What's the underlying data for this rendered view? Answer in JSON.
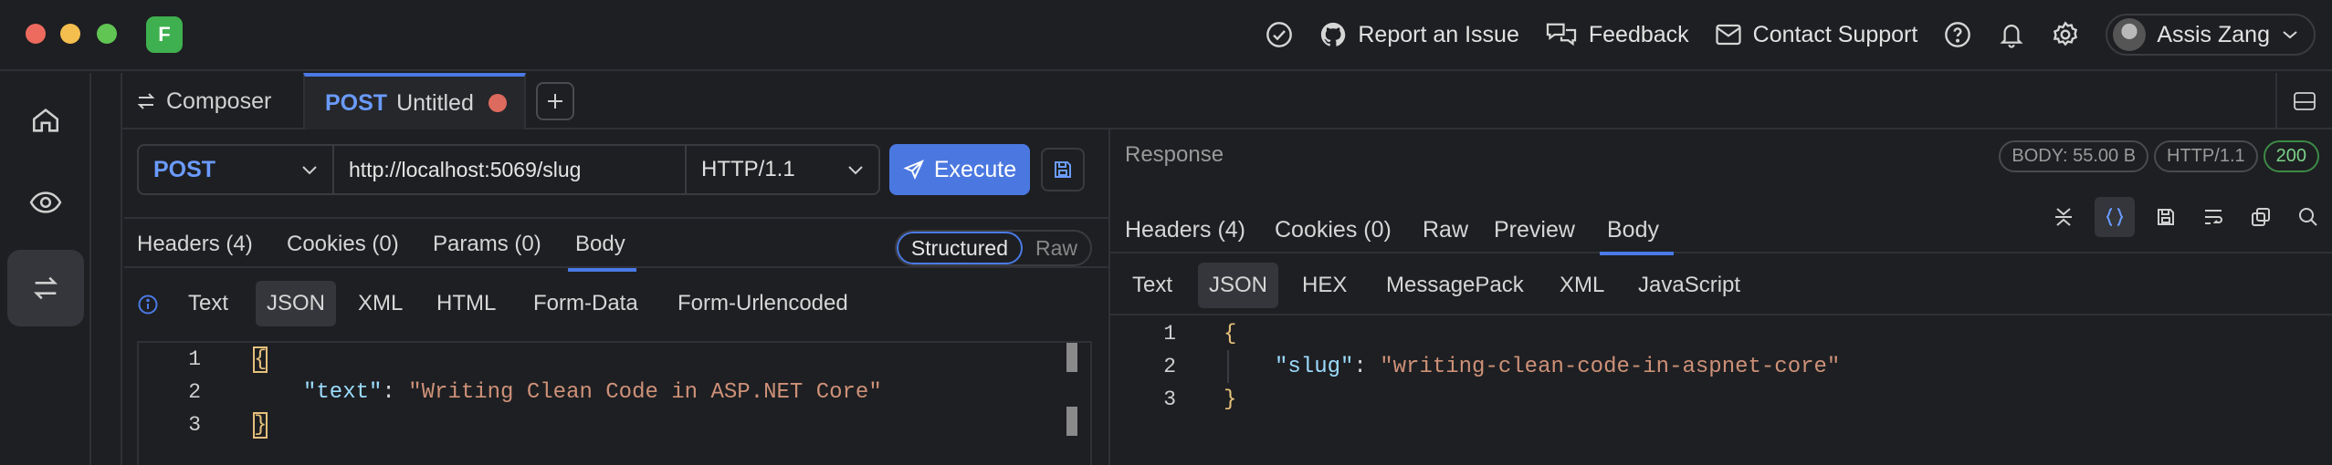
{
  "window": {
    "logo_letter": "F"
  },
  "header": {
    "report_issue": "Report an Issue",
    "feedback": "Feedback",
    "contact_support": "Contact Support",
    "user_name": "Assis Zang"
  },
  "tabs": {
    "composer": "Composer",
    "active_method": "POST",
    "active_title": "Untitled"
  },
  "request": {
    "method": "POST",
    "url": "http://localhost:5069/slug",
    "protocol": "HTTP/1.1",
    "execute_label": "Execute",
    "tabs": [
      {
        "label": "Headers (4)"
      },
      {
        "label": "Cookies (0)"
      },
      {
        "label": "Params (0)"
      },
      {
        "label": "Body"
      }
    ],
    "active_tab": "Body",
    "body_mode": {
      "structured": "Structured",
      "raw": "Raw"
    },
    "formats": [
      "Text",
      "JSON",
      "XML",
      "HTML",
      "Form-Data",
      "Form-Urlencoded"
    ],
    "active_format": "JSON",
    "editor": {
      "line_numbers": [
        "1",
        "2",
        "3"
      ],
      "open_brace": "{",
      "key": "\"text\"",
      "colon": ": ",
      "value": "\"Writing Clean Code in ASP.NET Core\"",
      "close_brace": "}"
    }
  },
  "response": {
    "title": "Response",
    "badges": {
      "body_size": "BODY: 55.00 B",
      "protocol": "HTTP/1.1",
      "status": "200"
    },
    "tabs": [
      {
        "label": "Headers (4)"
      },
      {
        "label": "Cookies (0)"
      },
      {
        "label": "Raw"
      },
      {
        "label": "Preview"
      },
      {
        "label": "Body"
      }
    ],
    "active_tab": "Body",
    "formats": [
      "Text",
      "JSON",
      "HEX",
      "MessagePack",
      "XML",
      "JavaScript"
    ],
    "active_format": "JSON",
    "editor": {
      "line_numbers": [
        "1",
        "2",
        "3"
      ],
      "open_brace": "{",
      "key": "\"slug\"",
      "colon": ": ",
      "value": "\"writing-clean-code-in-aspnet-core\"",
      "close_brace": "}"
    }
  },
  "colors": {
    "accent": "#4b78e0",
    "method": "#6a9bff",
    "status_ok": "#7bd389",
    "unsaved_dot": "#dd6a5e"
  }
}
